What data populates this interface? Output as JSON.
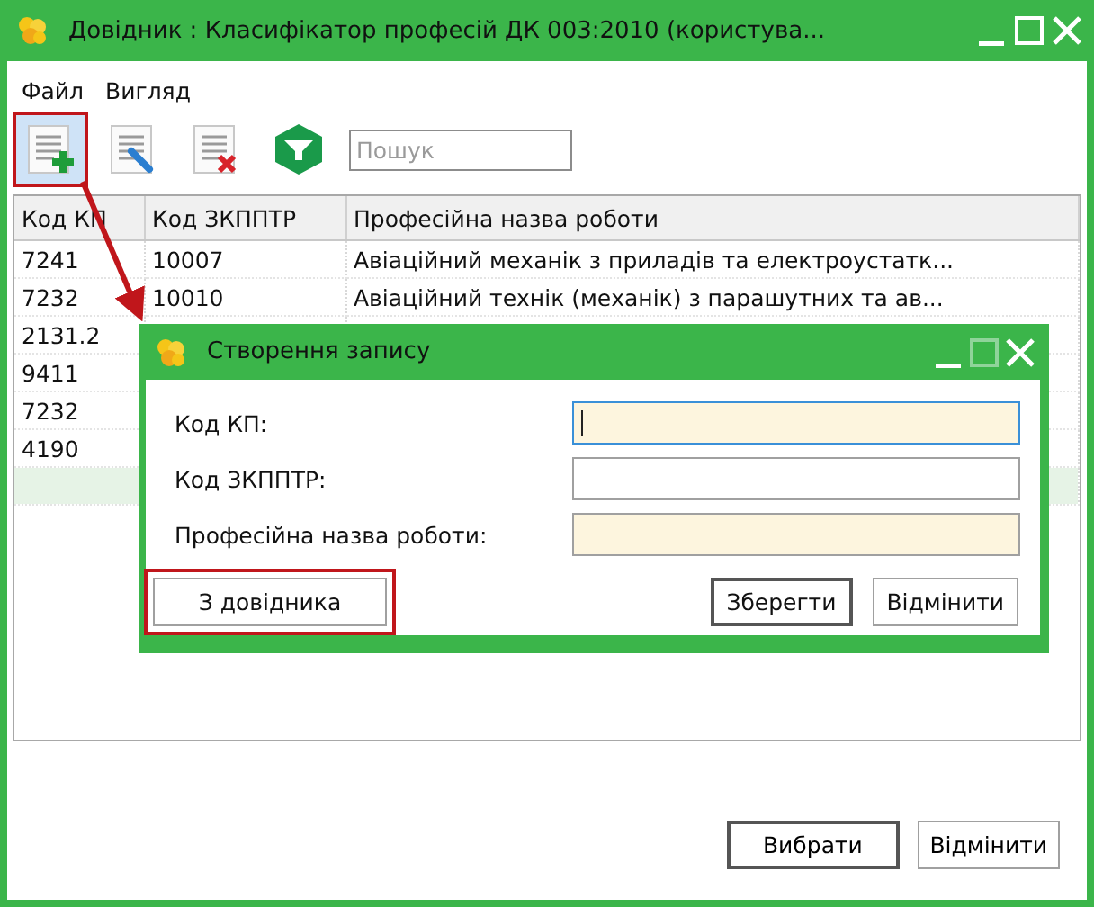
{
  "window": {
    "title": "Довідник : Класифікатор професій ДК 003:2010 (користува...",
    "buttons": [
      {
        "kind": "minimize",
        "disabled": false
      },
      {
        "kind": "maximize",
        "disabled": false
      },
      {
        "kind": "close",
        "disabled": false
      }
    ]
  },
  "menu": [
    "Файл",
    "Вигляд"
  ],
  "toolbar": {
    "tools": [
      {
        "kind": "add",
        "highlighted": true
      },
      {
        "kind": "edit",
        "highlighted": false
      },
      {
        "kind": "delete",
        "highlighted": false
      },
      {
        "kind": "filter",
        "highlighted": false
      }
    ],
    "search": {
      "placeholder": "Пошук"
    }
  },
  "table": {
    "columns": [
      "Код КП",
      "Код ЗКППТР",
      "Професійна назва роботи"
    ],
    "rows": [
      {
        "cells": [
          "7241",
          "10007",
          "Авіаційний механік з приладів та електроустатк..."
        ],
        "selected": false
      },
      {
        "cells": [
          "7232",
          "10010",
          "Авіаційний технік (механік) з парашутних та ав..."
        ],
        "selected": false
      },
      {
        "cells": [
          "2131.2"
        ],
        "selected": false
      },
      {
        "cells": [
          "9411"
        ],
        "selected": false
      },
      {
        "cells": [
          "7232"
        ],
        "selected": false
      },
      {
        "cells": [
          "4190"
        ],
        "selected": false
      },
      {
        "selected": true
      }
    ]
  },
  "footer_buttons": [
    {
      "label": "Вибрати",
      "default": true
    },
    {
      "label": "Відмінити",
      "default": false
    }
  ],
  "annotation_arrow": true,
  "dialog": {
    "title": "Створення запису",
    "buttons": [
      {
        "kind": "minimize",
        "disabled": false
      },
      {
        "kind": "maximize",
        "disabled": true
      },
      {
        "kind": "close",
        "disabled": false
      }
    ],
    "fields": [
      {
        "label": "Код КП:",
        "required": true,
        "focused": true
      },
      {
        "label": "Код ЗКППТР:",
        "required": false,
        "focused": false
      },
      {
        "label": "Професійна назва роботи:",
        "required": true,
        "focused": false
      }
    ],
    "buttons_row": [
      {
        "label": "З довідника",
        "kind": "left",
        "default": false,
        "highlighted": true
      },
      {
        "label": "Зберегти",
        "kind": "right",
        "default": true,
        "highlighted": false
      },
      {
        "label": "Відмінити",
        "kind": "right",
        "default": false,
        "highlighted": false
      }
    ]
  }
}
